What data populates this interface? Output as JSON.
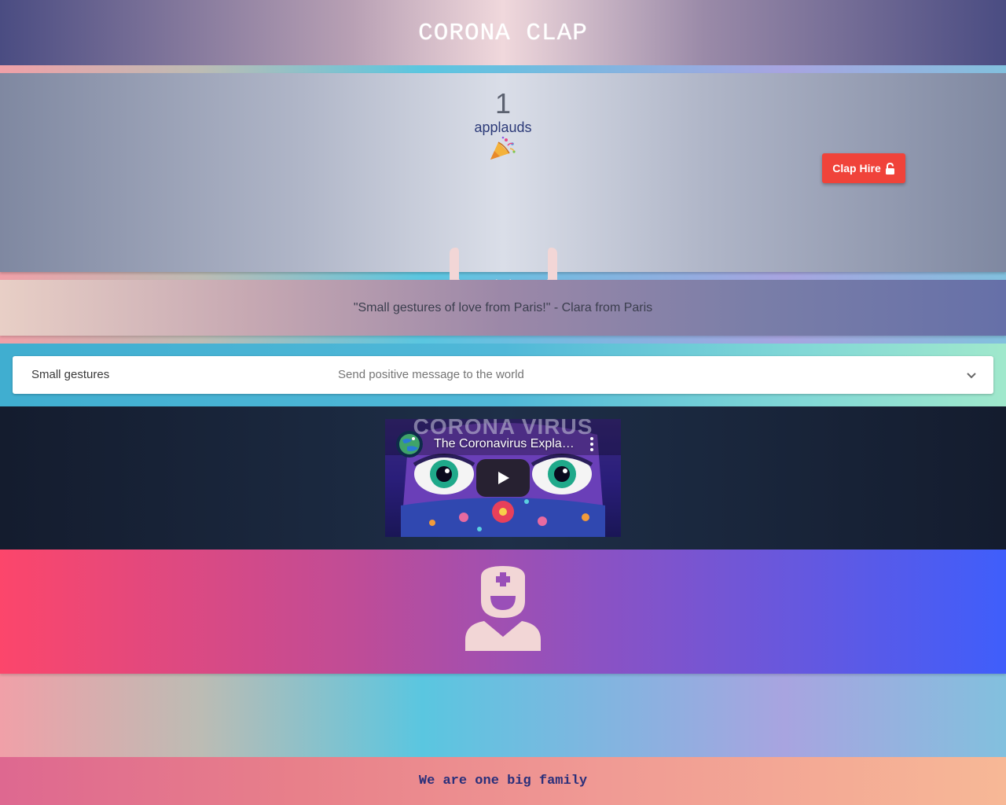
{
  "header": {
    "title": "CORONA CLAP"
  },
  "clap": {
    "count": "1",
    "count_label": "applauds",
    "party_icon": "party-popper-icon",
    "hands_icon": "praying-hands-icon",
    "hire_button_label": "Clap Hire",
    "hire_button_icon": "unlock-icon",
    "hire_button_color": "#f0433a"
  },
  "quote": {
    "text": "\"Small gestures of love from Paris!\" - Clara from Paris"
  },
  "accordion": {
    "title": "Small gestures",
    "subtitle": "Send positive message to the world",
    "icon": "chevron-down-icon"
  },
  "video": {
    "title": "The Coronavirus Explained & What You Should Do",
    "banner_text": "CORONA VIRUS",
    "play_icon": "play-icon",
    "menu_icon": "kebab-menu-icon"
  },
  "doctor": {
    "icon": "doctor-icon"
  },
  "footer": {
    "text": "We are one big family"
  }
}
